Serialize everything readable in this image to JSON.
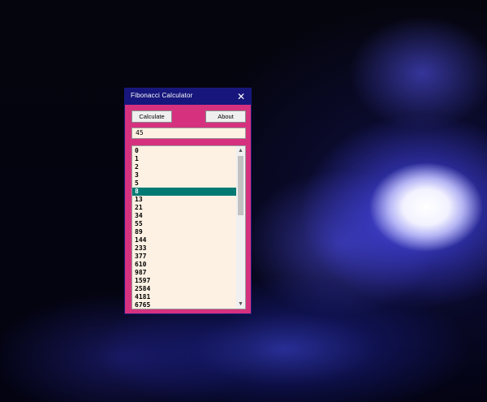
{
  "window": {
    "title": "Fibonacci Calculator",
    "close_glyph": "✕"
  },
  "toolbar": {
    "calculate_label": "Calculate",
    "about_label": "About"
  },
  "input": {
    "value": "45"
  },
  "results": {
    "items": [
      "0",
      "1",
      "2",
      "3",
      "5",
      "8",
      "13",
      "21",
      "34",
      "55",
      "89",
      "144",
      "233",
      "377",
      "610",
      "987",
      "1597",
      "2584",
      "4181",
      "6765"
    ],
    "selected_value": "8"
  },
  "scrollbar": {
    "up_glyph": "▲",
    "down_glyph": "▼"
  },
  "colors": {
    "titlebar": "#16167c",
    "window_body": "#d6317f",
    "field_background": "#fdf1e3",
    "selection": "#007a73"
  },
  "icons": {
    "close": "close-icon",
    "scroll_up": "chevron-up-icon",
    "scroll_down": "chevron-down-icon"
  }
}
